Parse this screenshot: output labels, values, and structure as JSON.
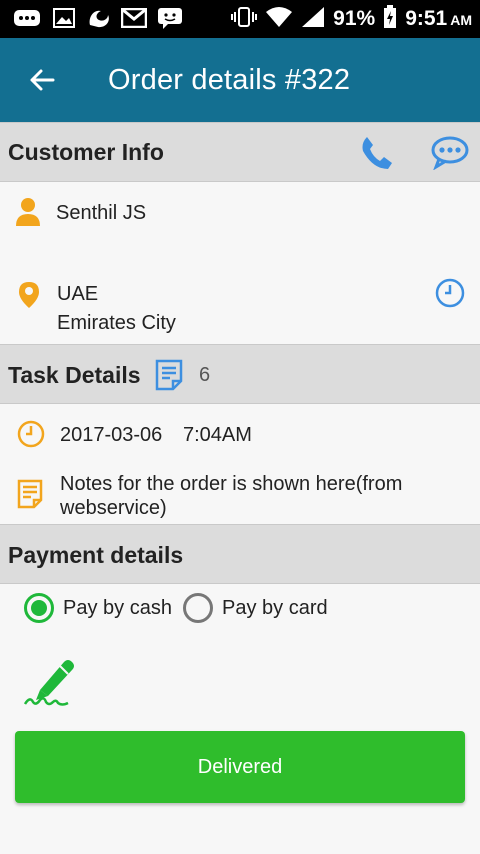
{
  "status_bar": {
    "battery_percent": "91%",
    "time": "9:51",
    "ampm": "AM",
    "icons": [
      "messenger-icon",
      "image-icon",
      "uc-browser-icon",
      "gmail-icon",
      "chat-icon",
      "vibrate-icon",
      "wifi-icon",
      "signal-icon",
      "battery-charging-icon"
    ]
  },
  "app_bar": {
    "title": "Order details #322",
    "back_icon": "arrow-left-icon"
  },
  "customer_info": {
    "heading": "Customer Info",
    "name": "Senthil JS",
    "address_line1": "UAE",
    "address_line2": "Emirates City",
    "icons": [
      "phone-icon",
      "message-icon",
      "person-icon",
      "location-pin-icon",
      "clock-icon"
    ]
  },
  "task_details": {
    "heading": "Task Details",
    "task_count": "6",
    "date": "2017-03-06",
    "time": "7:04AM",
    "notes": "Notes for the order is shown here(from webservice)",
    "icons": [
      "document-icon",
      "clock-icon",
      "notes-icon"
    ]
  },
  "payment_details": {
    "heading": "Payment details",
    "options": [
      {
        "label": "Pay by cash",
        "selected": true
      },
      {
        "label": "Pay by card",
        "selected": false
      }
    ],
    "signature_icon": "signature-pen-icon"
  },
  "actions": {
    "delivered_label": "Delivered"
  },
  "colors": {
    "app_bar": "#136f91",
    "accent_blue": "#3d8fe0",
    "accent_orange": "#f2a51d",
    "green": "#2fbd2c",
    "section_bg": "#dcdcdc"
  }
}
